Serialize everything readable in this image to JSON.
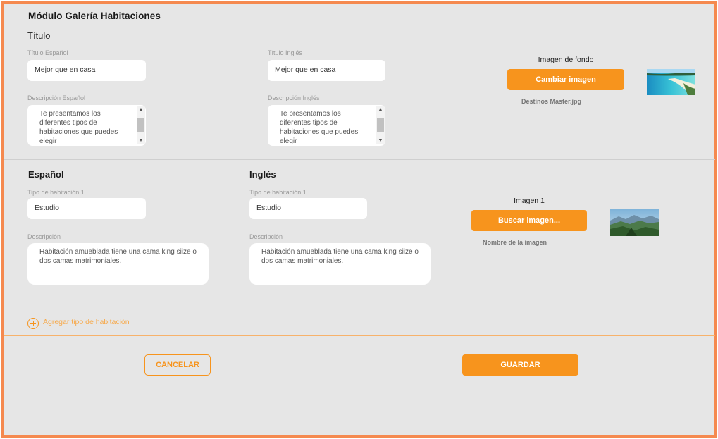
{
  "module": {
    "title": "Módulo Galería Habitaciones",
    "subtitle": "Título"
  },
  "header_form": {
    "title_es_label": "Título Español",
    "title_es_value": "Mejor que en casa",
    "title_en_label": "Título Inglés",
    "title_en_value": "Mejor que en casa",
    "desc_es_label": "Descripción Español",
    "desc_es_value": "Te presentamos los diferentes tipos de habitaciones que puedes elegir",
    "desc_en_label": "Descripción Inglés",
    "desc_en_value": "Te presentamos los diferentes tipos de habitaciones que puedes elegir"
  },
  "background_image": {
    "label": "Imagen de fondo",
    "button": "Cambiar imagen",
    "filename": "Destinos Master.jpg"
  },
  "room": {
    "es_heading": "Español",
    "en_heading": "Inglés",
    "type_es_label": "Tipo de habitación 1",
    "type_es_value": "Estudio",
    "type_en_label": "Tipo de habitación 1",
    "type_en_value": "Estudio",
    "desc_es_label": "Descripción",
    "desc_es_value": "Habitación amueblada tiene una cama king siize o dos camas matrimoniales.",
    "desc_en_label": "Descripción",
    "desc_en_value": "Habitación amueblada tiene una cama king siize o dos camas matrimoniales."
  },
  "room_image": {
    "label": "Imagen 1",
    "button": "Buscar imagen...",
    "filename": "Nombre de la imagen"
  },
  "add_room_type": "Agregar tipo de habitación",
  "footer": {
    "cancel": "CANCELAR",
    "save": "GUARDAR"
  },
  "colors": {
    "accent": "#f7941d",
    "frame_border": "#f5894f",
    "panel_bg": "#e6e6e6"
  },
  "icons": [
    "scroll-up-arrow-icon",
    "scroll-down-arrow-icon",
    "add-circle-icon"
  ]
}
